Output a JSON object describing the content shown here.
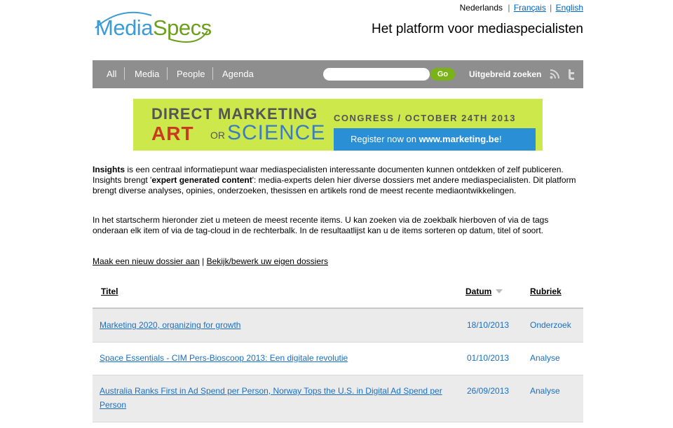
{
  "languages": [
    {
      "label": "Nederlands"
    },
    {
      "label": "Français"
    },
    {
      "label": "English"
    }
  ],
  "logo": {
    "text_a": "Media",
    "text_b": "Specs"
  },
  "tagline": "Het platform voor mediaspecialisten",
  "nav": {
    "items": [
      "All",
      "Media",
      "People",
      "Agenda"
    ],
    "search_placeholder": "",
    "go_label": "Go",
    "advanced_label": "Uitgebreid zoeken"
  },
  "banner": {
    "line1": "DIRECT MARKETING",
    "art": "ART",
    "or": "OR",
    "science": "SCIENCE",
    "congress": "CONGRESS / OCTOBER 24TH 2013",
    "register_prefix": "Register now on ",
    "register_url": "www.marketing.be",
    "register_suffix": "!"
  },
  "intro": {
    "p1_bold": "Insights",
    "p1_a": " is een centraal informatiepunt waar mediaspecialisten interessante documenten kunnen ontdekken of zelf publiceren. Insights brengt '",
    "p1_bold2": "expert generated content",
    "p1_b": "': media-experts delen hier diverse dossiers met andere mediaspecialisten. Dit platform brengt diverse analyses, opinies, onderzoeken, thesissen en artikels rond de meest recente mediaontwikkelingen.",
    "p2": "In het startscherm hieronder ziet u meteen de meest recente items. U kan zoeken via de zoekbalk hierboven of via de tags onderaan elk item of via de tag-cloud in de rechterbalk. In de resultaatlijst kan u de items sorteren op datum, titel of soort."
  },
  "links": {
    "new_dossier": "Maak een nieuw dossier aan",
    "separator": "|",
    "own_dossiers": "Bekijk/bewerk uw eigen dossiers"
  },
  "table": {
    "headers": {
      "title": "Titel",
      "date": "Datum",
      "rubriek": "Rubriek"
    },
    "rows": [
      {
        "title": "Marketing 2020, organizing for growth",
        "date": "18/10/2013",
        "rubriek": "Onderzoek"
      },
      {
        "title": "Space Essentials - CIM Pers-Bioscoop 2013: Een digitale revolutie",
        "date": "01/10/2013",
        "rubriek": "Analyse"
      },
      {
        "title": "Australia Ranks First in Ad Spend per Person, Norway Tops the U.S. in Digital Ad Spend per Person",
        "date": "26/09/2013",
        "rubriek": "Analyse"
      }
    ]
  },
  "colors": {
    "nav_bg": "#8e8e8e",
    "go_button": "#7ab317",
    "link": "#1a6fc2",
    "banner_bg": "#cde84a"
  }
}
